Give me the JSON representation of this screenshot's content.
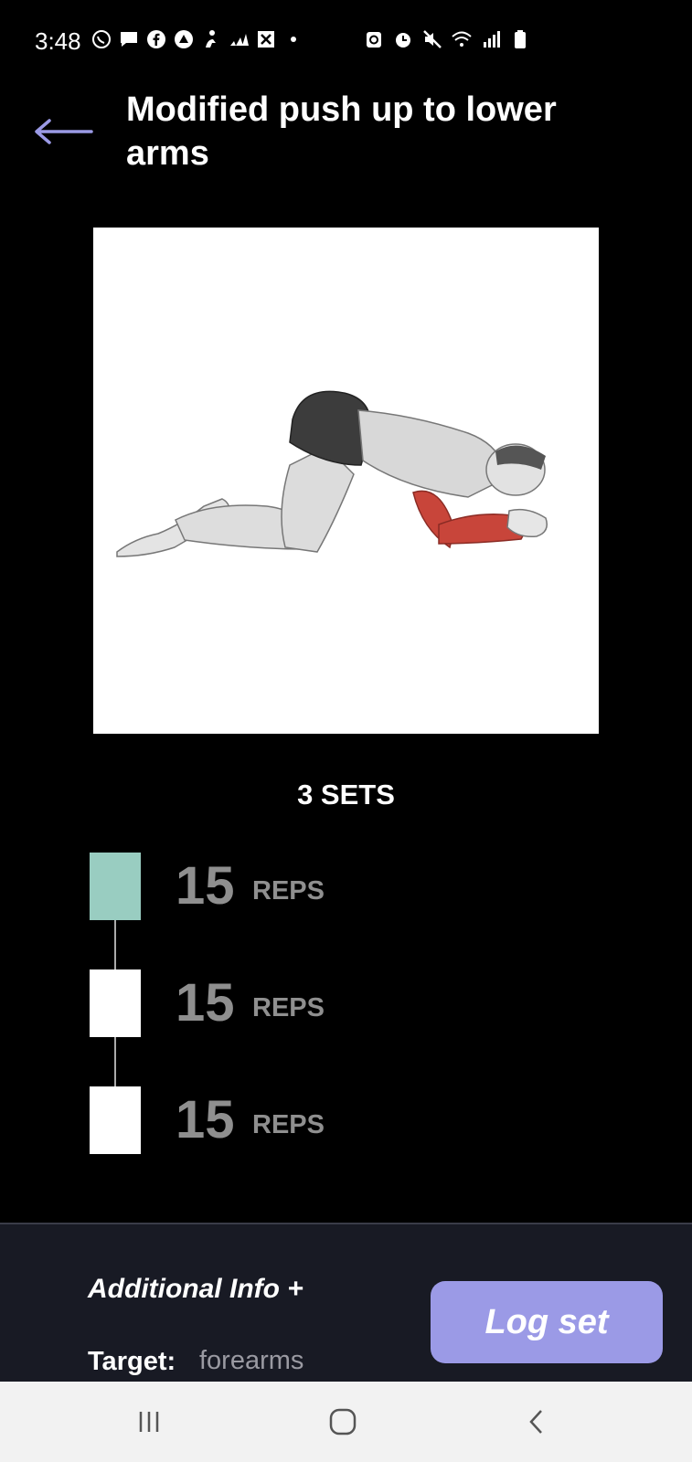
{
  "status_bar": {
    "time": "3:48",
    "left_icons": [
      "whatsapp-icon",
      "chat-icon",
      "facebook-icon",
      "app-icon",
      "fitness-icon",
      "adidas-icon",
      "app2-icon",
      "dot-icon"
    ],
    "right_icons": [
      "battery-saver-icon",
      "alarm-icon",
      "mute-icon",
      "wifi-icon",
      "signal-icon",
      "battery-icon"
    ]
  },
  "header": {
    "title": "Modified push up to lower arms"
  },
  "workout": {
    "sets_heading": "3 SETS",
    "sets": [
      {
        "reps": "15",
        "unit": "REPS",
        "completed": true
      },
      {
        "reps": "15",
        "unit": "REPS",
        "completed": false
      },
      {
        "reps": "15",
        "unit": "REPS",
        "completed": false
      }
    ]
  },
  "bottom_panel": {
    "additional_info": "Additional Info +",
    "target_label": "Target:",
    "target_value": "forearms",
    "log_set_label": "Log set"
  },
  "colors": {
    "accent": "#9b9ae6",
    "active_set": "#99cdc1",
    "panel_bg": "#181a24",
    "muscle_highlight": "#c8453a"
  }
}
